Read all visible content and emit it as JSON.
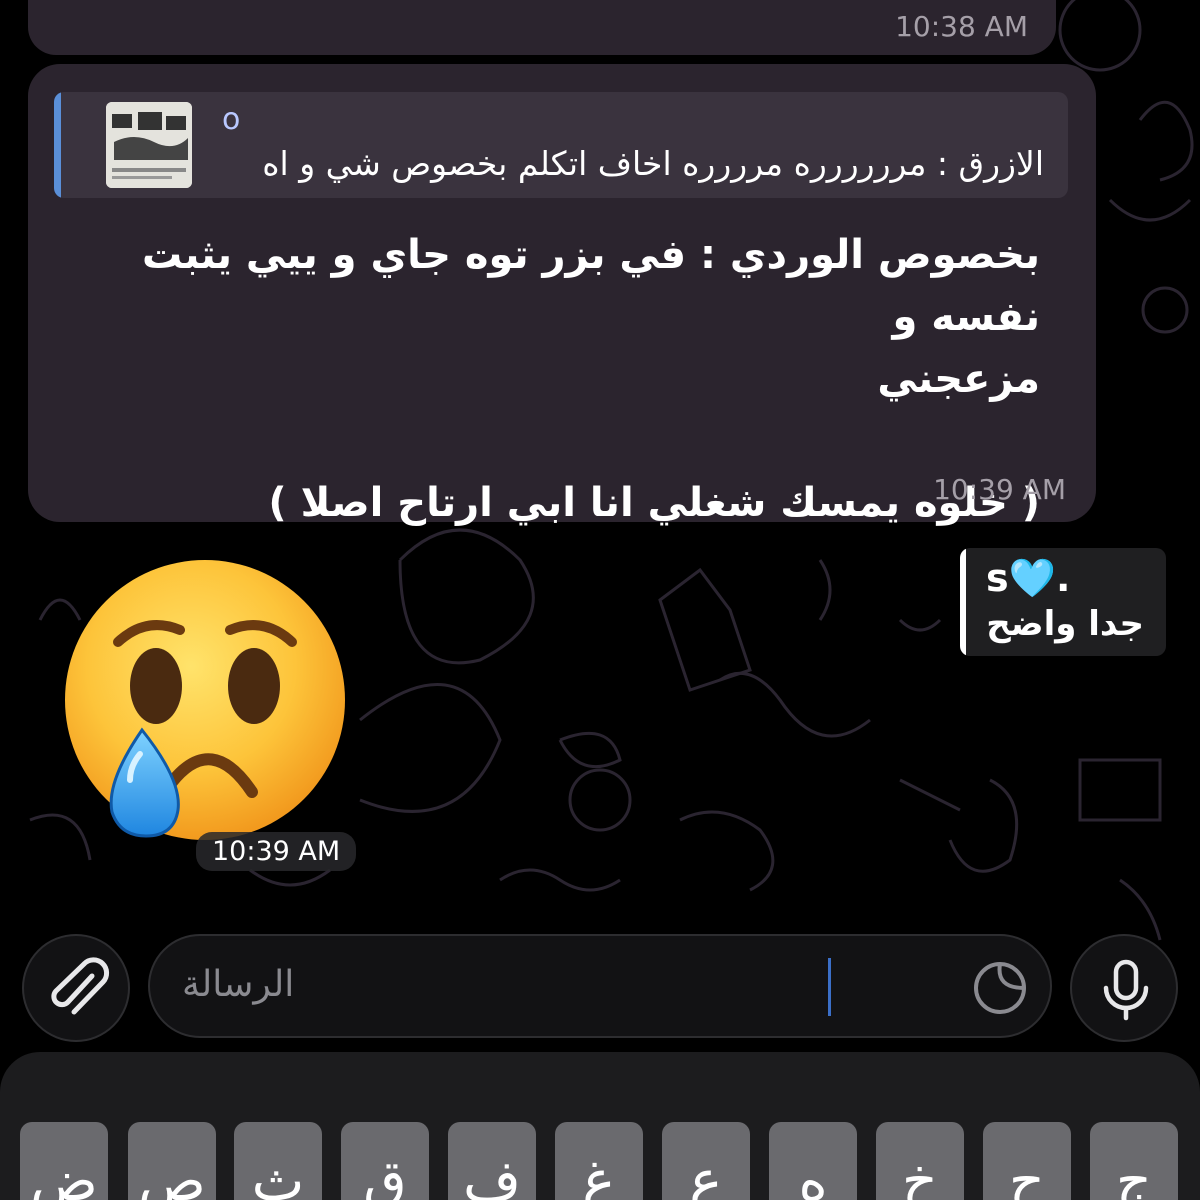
{
  "previous_message": {
    "time": "10:38 AM"
  },
  "message": {
    "reply": {
      "sender": "o",
      "text": "الازرق : مرررررره مرررره اخاف اتكلم بخصوص شي و اه"
    },
    "lines": [
      "بخصوص الوردي :  في بزر توه جاي و ييي يثبت نفسه و",
      "مزعجني",
      "",
      "( خلوه يمسك شغلي انا ابي ارتاح اصلا )"
    ],
    "time": "10:39 AM"
  },
  "outgoing": {
    "sender": "s",
    "heart": "🩵",
    "dot": ".",
    "text": "جدا واضح"
  },
  "emoji_message": {
    "icon": "crying-face-icon",
    "time": "10:39 AM"
  },
  "composer": {
    "placeholder": "الرسالة",
    "attach_icon": "paperclip-icon",
    "sticker_icon": "sticker-icon",
    "mic_icon": "microphone-icon"
  },
  "keyboard": {
    "row1": [
      "ض",
      "ص",
      "ث",
      "ق",
      "ف",
      "غ",
      "ع",
      "ه",
      "خ",
      "ح",
      "ج"
    ]
  },
  "colors": {
    "bubble": "#2b242e",
    "reply_bar": "#5a8fd8",
    "reply_name": "#b9c8ff"
  }
}
